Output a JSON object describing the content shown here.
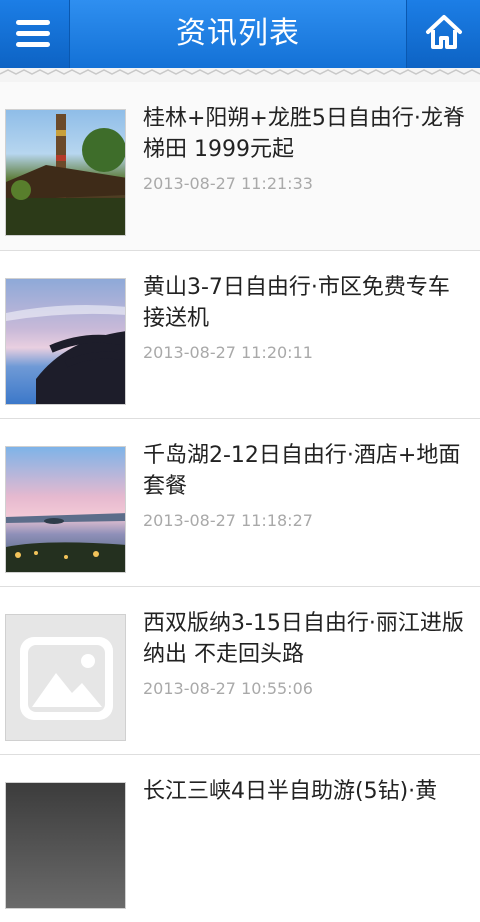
{
  "header": {
    "title": "资讯列表",
    "menu_icon": "menu-icon",
    "home_icon": "home-icon",
    "color": "#1f80e6"
  },
  "articles": [
    {
      "title": "桂林+阳朔+龙胜5日自由行·龙脊梯田 1999元起",
      "time": "2013-08-27 11:21:33",
      "image": "totem-pole-village-photo"
    },
    {
      "title": "黄山3-7日自由行·市区免费专车接送机",
      "time": "2013-08-27 11:20:11",
      "image": "pine-tree-sunset-photo"
    },
    {
      "title": "千岛湖2-12日自由行·酒店+地面套餐",
      "time": "2013-08-27 11:18:27",
      "image": "lake-dusk-photo"
    },
    {
      "title": "西双版纳3-15日自由行·丽江进版纳出 不走回头路",
      "time": "2013-08-27 10:55:06",
      "image": "image-placeholder-icon"
    },
    {
      "title": "长江三峡4日半自助游(5钻)·黄",
      "time": "",
      "image": "gorge-photo"
    }
  ]
}
